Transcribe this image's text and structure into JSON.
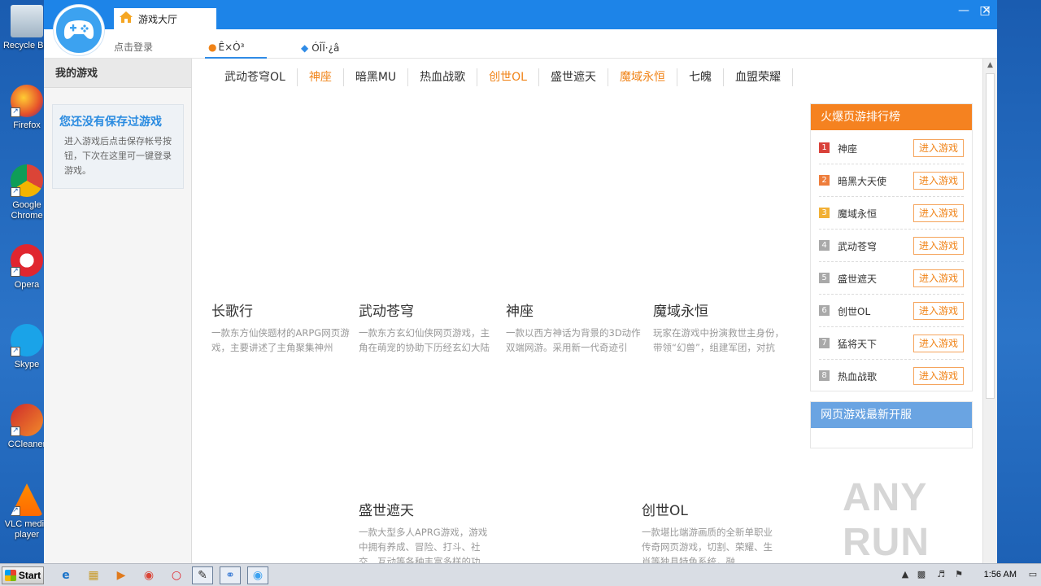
{
  "desktop": {
    "icons": [
      {
        "label": "Recycle Bin",
        "icon": "recycle-bin-icon"
      },
      {
        "label": "Firefox",
        "icon": "firefox-icon"
      },
      {
        "label": "Google\nChrome",
        "icon": "chrome-icon"
      },
      {
        "label": "Opera",
        "icon": "opera-icon"
      },
      {
        "label": "Skype",
        "icon": "skype-icon"
      },
      {
        "label": "CCleaner",
        "icon": "ccleaner-icon"
      },
      {
        "label": "VLC media\nplayer",
        "icon": "vlc-icon"
      }
    ]
  },
  "window": {
    "title_tab": "游戏大厅",
    "login_link": "点击登录",
    "nav_tabs": [
      "Ê×Ò³",
      "ÓÎÏ·¿â"
    ]
  },
  "sidebar": {
    "header": "我的游戏",
    "empty_title": "您还没有保存过游戏",
    "empty_desc": "进入游戏后点击保存帐号按钮，下次在这里可一键登录游戏。"
  },
  "category_nav": [
    {
      "label": "武动苍穹OL",
      "hot": false
    },
    {
      "label": "神座",
      "hot": true
    },
    {
      "label": "暗黑MU",
      "hot": false
    },
    {
      "label": "热血战歌",
      "hot": false
    },
    {
      "label": "创世OL",
      "hot": true
    },
    {
      "label": "盛世遮天",
      "hot": false
    },
    {
      "label": "魔域永恒",
      "hot": true
    },
    {
      "label": "七魄",
      "hot": false
    },
    {
      "label": "血盟荣耀",
      "hot": false
    }
  ],
  "games": [
    {
      "title": "长歌行",
      "desc": "一款东方仙侠题材的ARPG网页游戏，主要讲述了主角聚集神州"
    },
    {
      "title": "武动苍穹",
      "desc": "一款东方玄幻仙侠网页游戏，主角在萌宠的协助下历经玄幻大陆"
    },
    {
      "title": "神座",
      "desc": "一款以西方神话为背景的3D动作双端网游。采用新一代奇迹引"
    },
    {
      "title": "魔域永恒",
      "desc": "玩家在游戏中扮演救世主身份，带领“幻兽”，组建军团，对抗"
    },
    {
      "title": "盛世遮天",
      "desc": "一款大型多人APRG游戏，游戏中拥有养成、冒险、打斗、社交、互动等各种丰富多样的功"
    },
    {
      "title": "创世OL",
      "desc": "一款堪比端游画质的全新单职业传奇网页游戏，切割、荣耀、生肖等独具特色系统，融"
    }
  ],
  "ranking": {
    "title": "火爆页游排行榜",
    "button_label": "进入游戏",
    "items": [
      {
        "rank": "1",
        "name": "神座",
        "color": "#d9413a"
      },
      {
        "rank": "2",
        "name": "暗黑大天使",
        "color": "#ee7d3b"
      },
      {
        "rank": "3",
        "name": "魔域永恒",
        "color": "#f2b035"
      },
      {
        "rank": "4",
        "name": "武动苍穹",
        "color": "#a9a9a9"
      },
      {
        "rank": "5",
        "name": "盛世遮天",
        "color": "#a9a9a9"
      },
      {
        "rank": "6",
        "name": "创世OL",
        "color": "#a9a9a9"
      },
      {
        "rank": "7",
        "name": "猛将天下",
        "color": "#a9a9a9"
      },
      {
        "rank": "8",
        "name": "热血战歌",
        "color": "#a9a9a9"
      }
    ]
  },
  "new_servers": {
    "title": "网页游戏最新开服"
  },
  "watermark": "ANY RUN",
  "taskbar": {
    "start_label": "Start",
    "clock": "1:56 AM",
    "items": [
      "ie-icon",
      "explorer-icon",
      "media-player-icon",
      "chrome-icon",
      "opera-icon",
      "tool-icon",
      "cursor-app-icon",
      "game-hall-icon"
    ]
  },
  "colors": {
    "accent": "#1d84e8",
    "orange": "#f58220",
    "hot_text": "#f08317",
    "blue_panel": "#6aa4e2"
  }
}
